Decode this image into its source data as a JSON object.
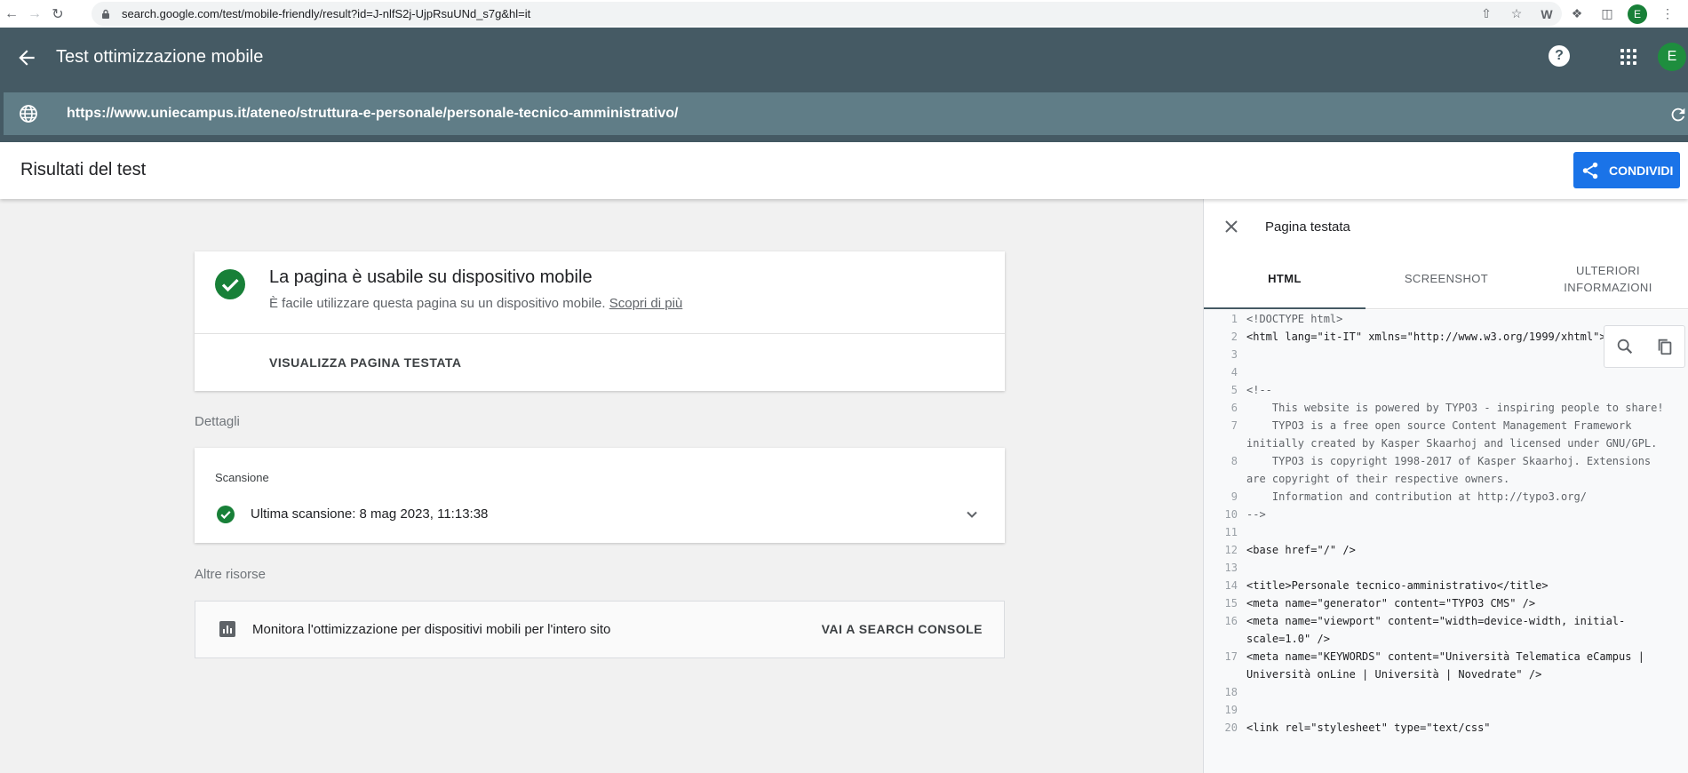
{
  "browser": {
    "url": "search.google.com/test/mobile-friendly/result?id=J-nlfS2j-UjpRsuUNd_s7g&hl=it",
    "avatar_letter": "E"
  },
  "header": {
    "title": "Test ottimizzazione mobile",
    "tested_url": "https://www.uniecampus.it/ateneo/struttura-e-personale/personale-tecnico-amministrativo/",
    "avatar_letter": "E",
    "help_glyph": "?"
  },
  "results": {
    "title": "Risultati del test",
    "share_label": "CONDIVIDI"
  },
  "main_card": {
    "heading": "La pagina è usabile su dispositivo mobile",
    "subtext": "È facile utilizzare questa pagina su un dispositivo mobile.",
    "learn_more": "Scopri di più",
    "view_page_label": "VISUALIZZA PAGINA TESTATA",
    "status_color": "#188038"
  },
  "details": {
    "label": "Dettagli",
    "scan_title": "Scansione",
    "last_scan": "Ultima scansione: 8 mag 2023, 11:13:38"
  },
  "resources": {
    "label": "Altre risorse",
    "text": "Monitora l'ottimizzazione per dispositivi mobili per l'intero sito",
    "link": "VAI A SEARCH CONSOLE"
  },
  "panel": {
    "title": "Pagina testata",
    "tabs": [
      {
        "label": "HTML",
        "active": true
      },
      {
        "label": "SCREENSHOT",
        "active": false
      },
      {
        "label": "ULTERIORI INFORMAZIONI",
        "active": false
      }
    ],
    "code_lines": [
      {
        "n": "1",
        "text": "<!DOCTYPE html>"
      },
      {
        "n": "2",
        "text": "<html lang=\"it-IT\" xmlns=\"http://www.w3.org/1999/xhtml\">"
      },
      {
        "n": "3",
        "text": ""
      },
      {
        "n": "4",
        "text": ""
      },
      {
        "n": "5",
        "text": "<!--"
      },
      {
        "n": "6",
        "text": "    This website is powered by TYPO3 - inspiring people to share!"
      },
      {
        "n": "7",
        "text": "    TYPO3 is a free open source Content Management Framework initially created by Kasper Skaarhoj and licensed under GNU/GPL."
      },
      {
        "n": "8",
        "text": "    TYPO3 is copyright 1998-2017 of Kasper Skaarhoj. Extensions are copyright of their respective owners."
      },
      {
        "n": "9",
        "text": "    Information and contribution at http://typo3.org/"
      },
      {
        "n": "10",
        "text": "-->"
      },
      {
        "n": "11",
        "text": ""
      },
      {
        "n": "12",
        "text": "<base href=\"/\" />"
      },
      {
        "n": "13",
        "text": ""
      },
      {
        "n": "14",
        "text": "<title>Personale tecnico-amministrativo</title>"
      },
      {
        "n": "15",
        "text": "<meta name=\"generator\" content=\"TYPO3 CMS\" />"
      },
      {
        "n": "16",
        "text": "<meta name=\"viewport\" content=\"width=device-width, initial-scale=1.0\" />"
      },
      {
        "n": "17",
        "text": "<meta name=\"KEYWORDS\" content=\"Università Telematica eCampus | Università onLine | Università | Novedrate\" />"
      },
      {
        "n": "18",
        "text": ""
      },
      {
        "n": "19",
        "text": ""
      },
      {
        "n": "20",
        "text": "<link rel=\"stylesheet\" type=\"text/css\""
      }
    ]
  }
}
